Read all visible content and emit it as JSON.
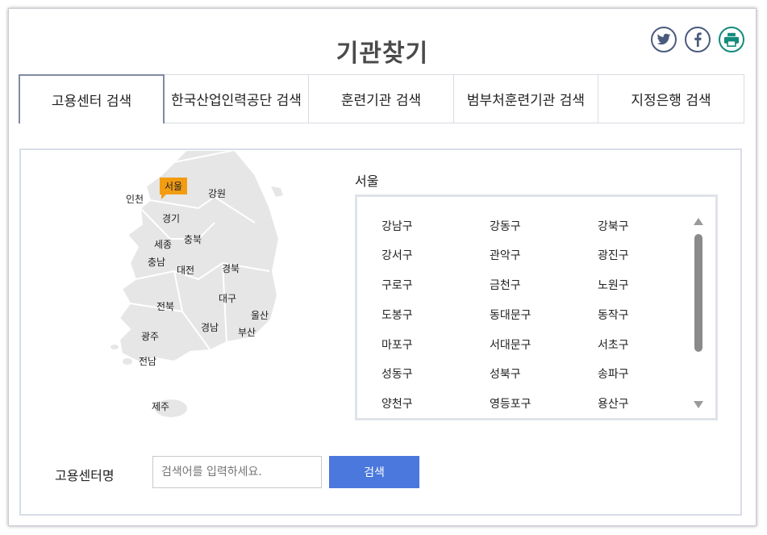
{
  "page_title": "기관찾기",
  "share": {
    "twitter": "twitter-icon",
    "facebook": "facebook-icon",
    "print": "print-icon"
  },
  "tabs": [
    {
      "label": "고용센터 검색",
      "active": true
    },
    {
      "label": "한국산업인력공단 검색",
      "active": false
    },
    {
      "label": "훈련기관 검색",
      "active": false
    },
    {
      "label": "범부처훈련기관 검색",
      "active": false
    },
    {
      "label": "지정은행 검색",
      "active": false
    }
  ],
  "map": {
    "selected": "서울",
    "regions": [
      "인천",
      "강원",
      "경기",
      "세종",
      "충북",
      "충남",
      "대전",
      "경북",
      "대구",
      "전북",
      "울산",
      "경남",
      "부산",
      "광주",
      "전남",
      "제주"
    ]
  },
  "list": {
    "title": "서울",
    "districts": [
      "강남구",
      "강동구",
      "강북구",
      "강서구",
      "관악구",
      "광진구",
      "구로구",
      "금천구",
      "노원구",
      "도봉구",
      "동대문구",
      "동작구",
      "마포구",
      "서대문구",
      "서초구",
      "성동구",
      "성북구",
      "송파구",
      "양천구",
      "영등포구",
      "용산구"
    ]
  },
  "search": {
    "label": "고용센터명",
    "placeholder": "검색어를 입력하세요.",
    "button": "검색"
  },
  "colors": {
    "accent": "#4a78dc",
    "selected_region": "#f39c12"
  }
}
